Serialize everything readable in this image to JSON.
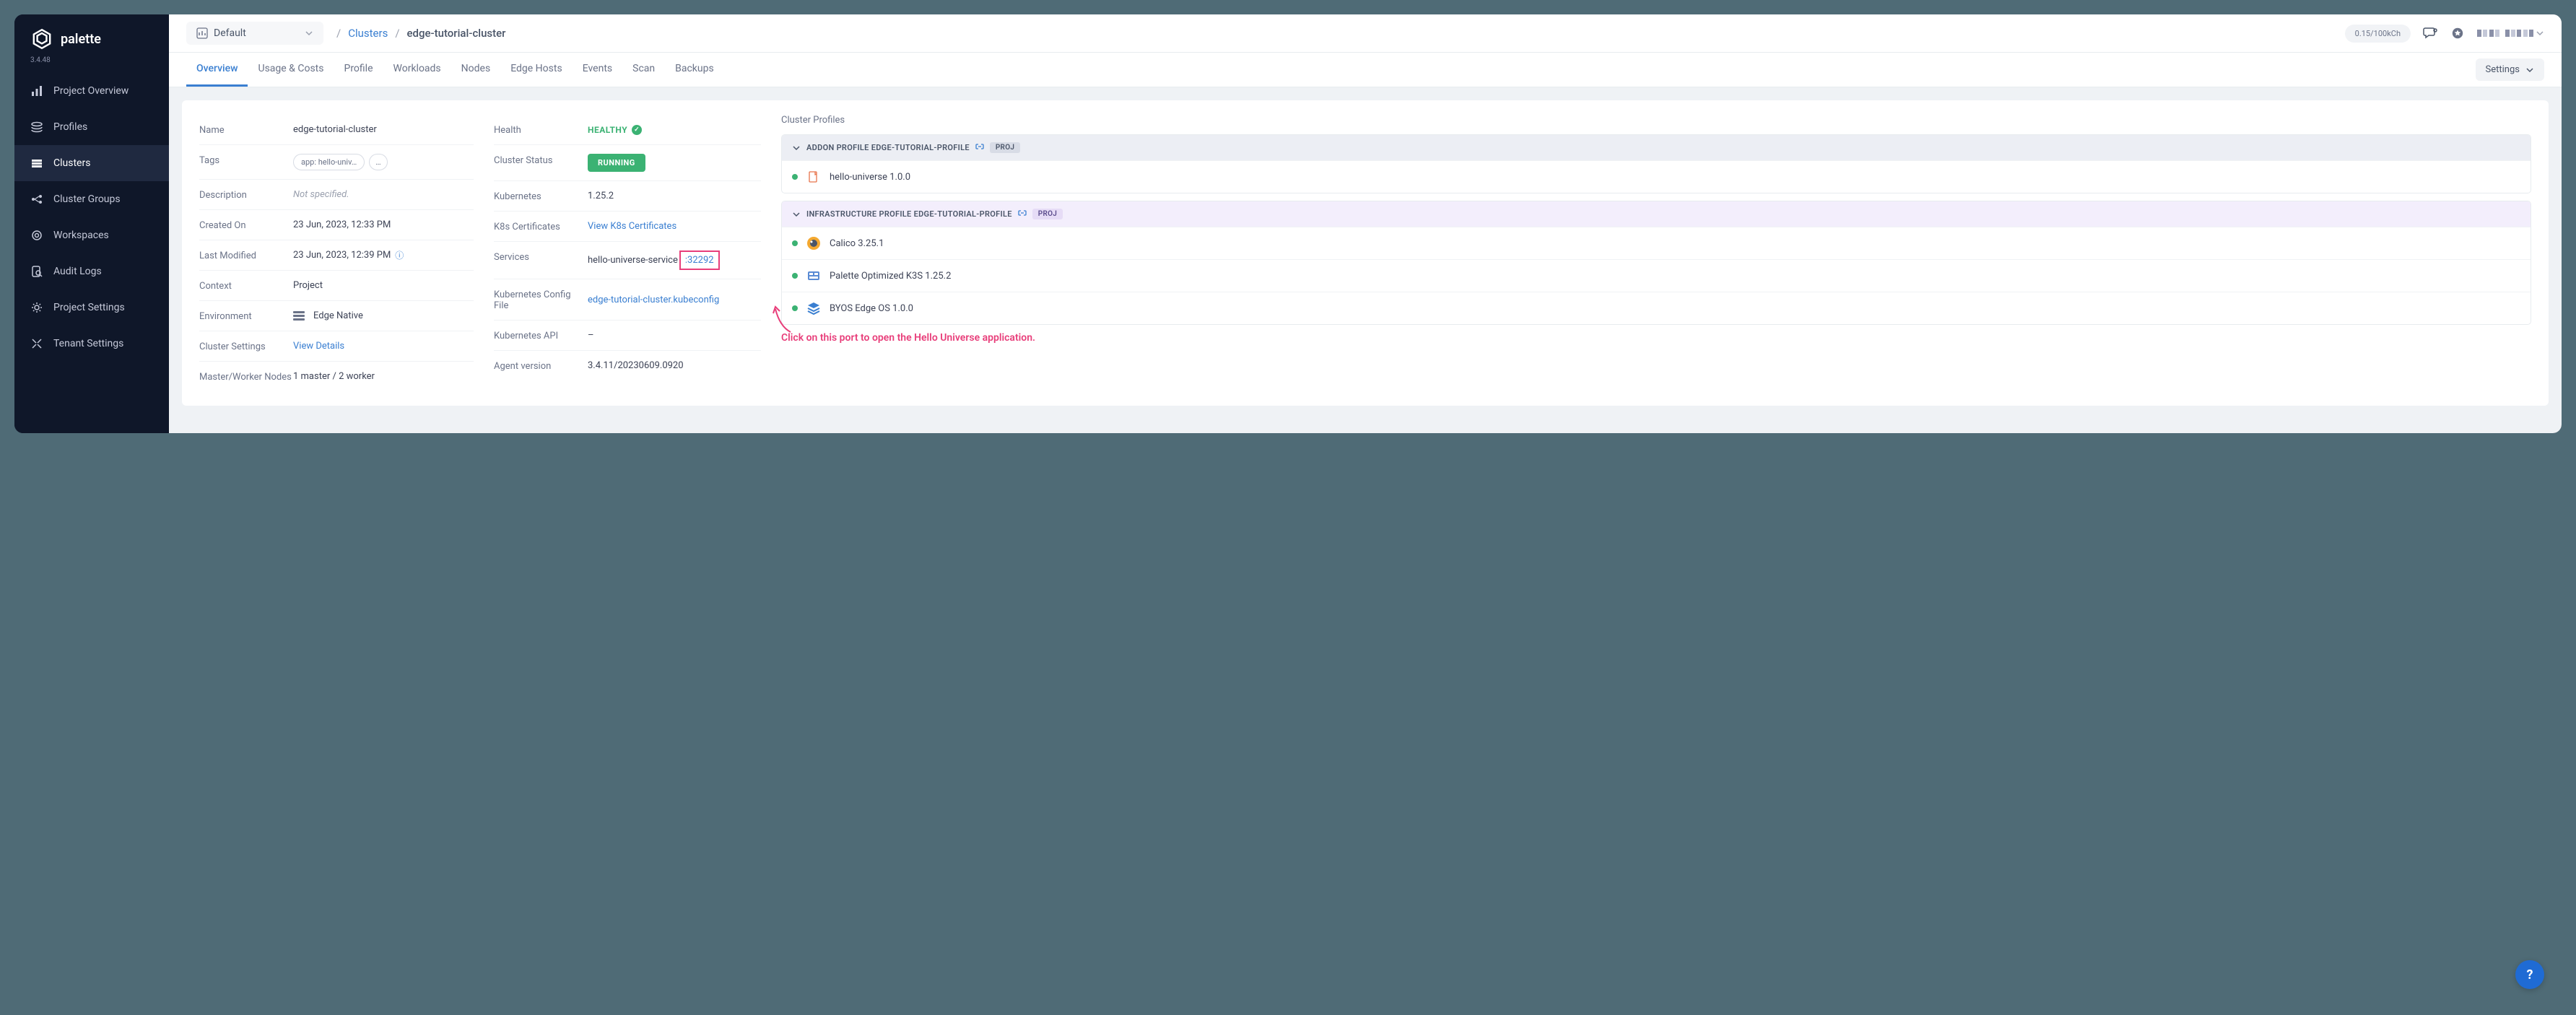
{
  "brand": {
    "name": "palette",
    "version": "3.4.48"
  },
  "sidebar": {
    "items": [
      {
        "label": "Project Overview",
        "icon": "bar-chart-icon"
      },
      {
        "label": "Profiles",
        "icon": "layers-icon"
      },
      {
        "label": "Clusters",
        "icon": "grid-icon"
      },
      {
        "label": "Cluster Groups",
        "icon": "group-icon"
      },
      {
        "label": "Workspaces",
        "icon": "target-icon"
      },
      {
        "label": "Audit Logs",
        "icon": "search-file-icon"
      },
      {
        "label": "Project Settings",
        "icon": "gear-icon"
      },
      {
        "label": "Tenant Settings",
        "icon": "tools-icon"
      }
    ],
    "active_index": 2
  },
  "topbar": {
    "project_selector": "Default",
    "breadcrumb": {
      "link": "Clusters",
      "current": "edge-tutorial-cluster"
    },
    "usage": "0.15/100kCh"
  },
  "tabs": {
    "items": [
      "Overview",
      "Usage & Costs",
      "Profile",
      "Workloads",
      "Nodes",
      "Edge Hosts",
      "Events",
      "Scan",
      "Backups"
    ],
    "active_index": 0,
    "settings_label": "Settings"
  },
  "details_left": {
    "name": {
      "label": "Name",
      "value": "edge-tutorial-cluster"
    },
    "tags": {
      "label": "Tags",
      "chip": "app: hello-univ…",
      "more": "…"
    },
    "description": {
      "label": "Description",
      "value": "Not specified."
    },
    "created_on": {
      "label": "Created On",
      "value": "23 Jun, 2023, 12:33 PM"
    },
    "last_modified": {
      "label": "Last Modified",
      "value": "23 Jun, 2023, 12:39 PM"
    },
    "context": {
      "label": "Context",
      "value": "Project"
    },
    "environment": {
      "label": "Environment",
      "value": "Edge Native"
    },
    "cluster_settings": {
      "label": "Cluster Settings",
      "value": "View Details"
    },
    "master_worker": {
      "label": "Master/Worker Nodes",
      "value": "1 master / 2 worker"
    }
  },
  "details_mid": {
    "health": {
      "label": "Health",
      "value": "HEALTHY"
    },
    "cluster_status": {
      "label": "Cluster Status",
      "value": "RUNNING"
    },
    "kubernetes": {
      "label": "Kubernetes",
      "value": "1.25.2"
    },
    "k8s_certs": {
      "label": "K8s Certificates",
      "value": "View K8s Certificates"
    },
    "services": {
      "label": "Services",
      "value": "hello-universe-service",
      "port": ":32292"
    },
    "kubeconfig": {
      "label": "Kubernetes Config File",
      "value": "edge-tutorial-cluster.kubeconfig"
    },
    "k8s_api": {
      "label": "Kubernetes API",
      "value": "–"
    },
    "agent_version": {
      "label": "Agent version",
      "value": "3.4.11/20230609.0920"
    }
  },
  "profiles": {
    "title": "Cluster Profiles",
    "addon": {
      "header": "ADDON PROFILE EDGE-TUTORIAL-PROFILE",
      "badge": "PROJ",
      "items": [
        {
          "label": "hello-universe 1.0.0"
        }
      ]
    },
    "infra": {
      "header": "INFRASTRUCTURE PROFILE EDGE-TUTORIAL-PROFILE",
      "badge": "PROJ",
      "items": [
        {
          "label": "Calico 3.25.1"
        },
        {
          "label": "Palette Optimized K3S 1.25.2"
        },
        {
          "label": "BYOS Edge OS 1.0.0"
        }
      ]
    }
  },
  "callout": "Click on this port to open the Hello Universe application.",
  "help": "?"
}
